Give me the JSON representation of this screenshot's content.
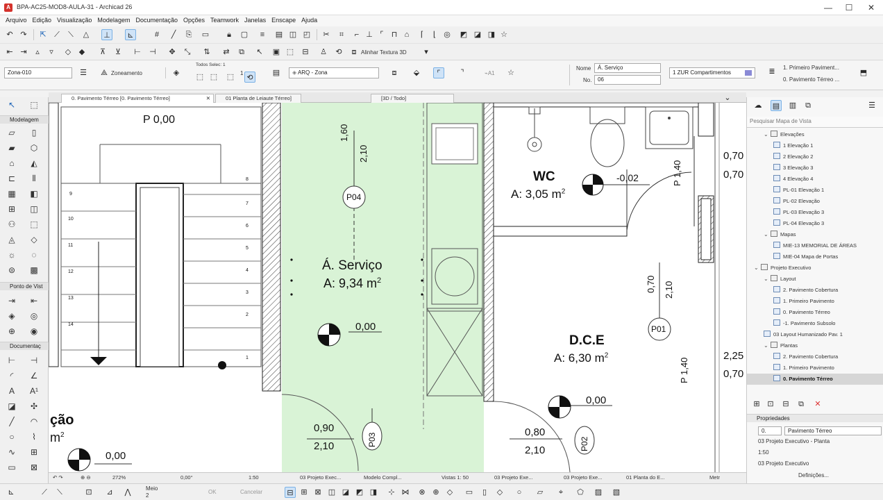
{
  "window": {
    "title": "BPA-AC25-MOD8-AULA-31 - Archicad 26",
    "minimize": "—",
    "maximize": "☐",
    "close": "✕"
  },
  "menu": [
    "Arquivo",
    "Edição",
    "Visualização",
    "Modelagem",
    "Documentação",
    "Opções",
    "Teamwork",
    "Janelas",
    "Enscape",
    "Ajuda"
  ],
  "toolbar": {
    "align_texture_label": "Alinhar Textura 3D"
  },
  "info_box": {
    "zone_name_field": "Zona-010",
    "zoning_button": "Zoneamento",
    "all_selected_label": "Todos Selec: 1",
    "selected_count": "1",
    "layer_value": "ARQ - Zona",
    "name_label": "Nome",
    "name_value": "Á. Serviço",
    "number_label": "No.",
    "number_value": "06",
    "category_value": "1 ZUR  Compartimentos",
    "story_top": "1. Primeiro Paviment...",
    "story_bottom": "0. Pavimento Térreo ..."
  },
  "tabs": [
    {
      "label": "0. Pavimento Térreo [0. Pavimento Térreo]",
      "active": true
    },
    {
      "label": "01 Planta de Leiaute Térreo]",
      "active": false
    },
    {
      "label": "[3D / Todo]",
      "active": false
    }
  ],
  "left_panel": {
    "sections": [
      "Modelagem",
      "Ponto de Vist",
      "Documentaç"
    ]
  },
  "drawing": {
    "stair_level": "P 0,00",
    "stair_numbers_right": [
      "8",
      "7",
      "6",
      "5",
      "4",
      "3",
      "2",
      "1"
    ],
    "stair_numbers_left": [
      "9",
      "10",
      "11",
      "12",
      "13",
      "14"
    ],
    "zone_service_name": "Á. Serviço",
    "zone_service_area": "A: 9,34 m",
    "zone_service_level": "0,00",
    "door_p04": "P04",
    "door_p04_dims": [
      "1,60",
      "2,10"
    ],
    "zone_wc_name": "WC",
    "zone_wc_area": "A: 3,05 m",
    "zone_wc_level": "-0,02",
    "wc_window": "P 1,40",
    "wc_window_dims": [
      "0,70",
      "0,70"
    ],
    "door_p01": "P01",
    "door_p01_dims": [
      "0,70",
      "2,10"
    ],
    "zone_dce_name": "D.C.E",
    "zone_dce_area": "A: 6,30 m",
    "zone_dce_level": "0,00",
    "dce_window": "P 1,40",
    "dce_window_dims": [
      "2,25",
      "0,70"
    ],
    "door_p03": "P03",
    "door_p03_dims": [
      "0,90",
      "2,10"
    ],
    "door_p02": "P02",
    "door_p02_dims": [
      "0,80",
      "2,10"
    ],
    "left_zone_partial": "ção",
    "left_zone_area": "m",
    "left_zone_level": "0,00",
    "square_sup": "2"
  },
  "navigator": {
    "search_placeholder": "Pesquisar Mapa de Vista",
    "items": [
      {
        "label": "Elevações",
        "indent": 1,
        "type": "folder"
      },
      {
        "label": "1 Elevação 1",
        "indent": 2,
        "type": "view"
      },
      {
        "label": "2 Elevação 2",
        "indent": 2,
        "type": "view"
      },
      {
        "label": "3 Elevação 3",
        "indent": 2,
        "type": "view"
      },
      {
        "label": "4 Elevação 4",
        "indent": 2,
        "type": "view"
      },
      {
        "label": "PL-01 Elevação 1",
        "indent": 2,
        "type": "view"
      },
      {
        "label": "PL-02 Elevação",
        "indent": 2,
        "type": "view"
      },
      {
        "label": "PL-03 Elevação 3",
        "indent": 2,
        "type": "view"
      },
      {
        "label": "PL-04 Elevação 3",
        "indent": 2,
        "type": "view"
      },
      {
        "label": "Mapas",
        "indent": 1,
        "type": "folder"
      },
      {
        "label": "MIE-13 MEMORIAL DE ÁREAS",
        "indent": 2,
        "type": "view"
      },
      {
        "label": "MIE-04 Mapa de Portas",
        "indent": 2,
        "type": "view"
      },
      {
        "label": "Projeto Executivo",
        "indent": 0,
        "type": "folder"
      },
      {
        "label": "Layout",
        "indent": 1,
        "type": "folder"
      },
      {
        "label": "2. Pavimento Cobertura",
        "indent": 2,
        "type": "view"
      },
      {
        "label": "1. Primeiro Pavimento",
        "indent": 2,
        "type": "view"
      },
      {
        "label": "0. Pavimento Térreo",
        "indent": 2,
        "type": "view"
      },
      {
        "label": "-1. Pavimento Subsolo",
        "indent": 2,
        "type": "view"
      },
      {
        "label": "03 Layout Humanizado Pav. 1",
        "indent": 1,
        "type": "view"
      },
      {
        "label": "Plantas",
        "indent": 1,
        "type": "folder"
      },
      {
        "label": "2. Pavimento Cobertura",
        "indent": 2,
        "type": "view"
      },
      {
        "label": "1. Primeiro Pavimento",
        "indent": 2,
        "type": "view"
      },
      {
        "label": "0. Pavimento Térreo",
        "indent": 2,
        "type": "view",
        "selected": true
      }
    ],
    "properties_title": "Propriedades",
    "prop_id": "0.",
    "prop_name": "Pavimento Térreo",
    "prop_source": "03 Projeto Executivo - Planta",
    "prop_scale": "1:50",
    "prop_folder": "03 Projeto Executivo",
    "settings_button": "Definições..."
  },
  "statusbar": {
    "zoom": "272%",
    "angle": "0,00°",
    "scale": "1:50",
    "layer_combo": "03 Projeto Exec...",
    "model_view": "Modelo Compl...",
    "views_label": "Vistas 1: 50",
    "pen_set": "03 Projeto Exe...",
    "dim_std": "03 Projeto Exe...",
    "renovation": "01 Planta do E...",
    "units": "Metr"
  },
  "bottombar": {
    "middle_label": "Meio",
    "middle_value": "2",
    "ok_button": "OK",
    "cancel_button": "Cancelar"
  }
}
